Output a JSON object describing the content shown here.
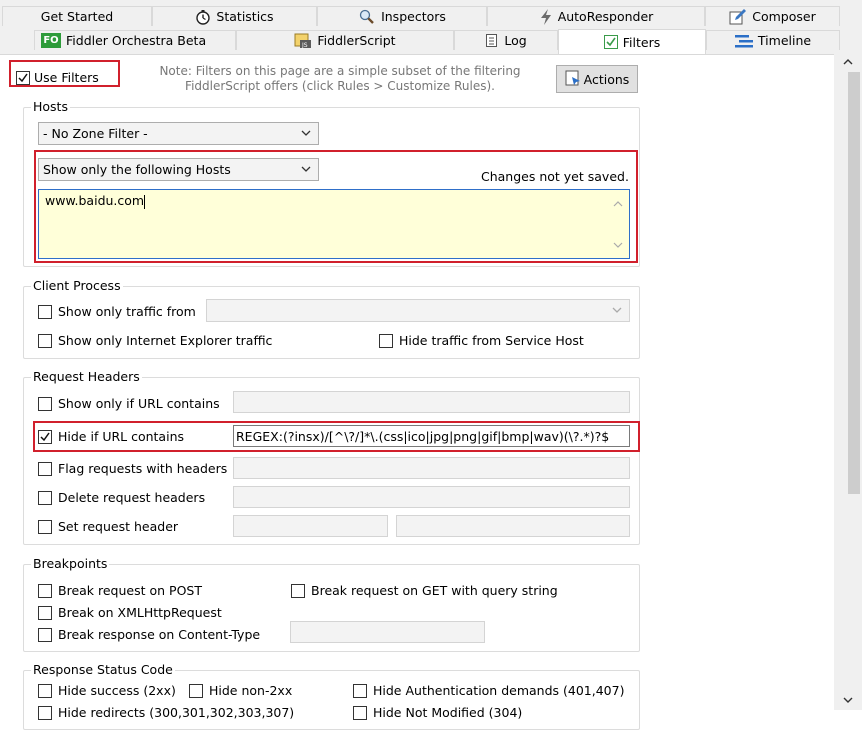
{
  "tabs": {
    "row1": [
      {
        "label": "Get Started"
      },
      {
        "label": "Statistics"
      },
      {
        "label": "Inspectors"
      },
      {
        "label": "AutoResponder"
      },
      {
        "label": "Composer"
      }
    ],
    "row2": [
      {
        "label": "Fiddler Orchestra Beta",
        "badge": "FO"
      },
      {
        "label": "FiddlerScript"
      },
      {
        "label": "Log"
      },
      {
        "label": "Filters"
      },
      {
        "label": "Timeline"
      }
    ]
  },
  "top": {
    "use_filters": "Use Filters",
    "note": "Note: Filters on this page are a simple subset of the filtering FiddlerScript offers (click Rules > Customize Rules).",
    "note_line1": "Note: Filters on this page are a simple subset of the filtering",
    "note_line2": "FiddlerScript offers (click Rules > Customize Rules).",
    "actions": "Actions"
  },
  "hosts": {
    "legend": "Hosts",
    "zone_filter": "- No Zone Filter -",
    "host_filter": "Show only the following Hosts",
    "status": "Changes not yet saved.",
    "host_list": "www.baidu.com"
  },
  "client": {
    "legend": "Client Process",
    "show_only_traffic_from": "Show only traffic from",
    "show_only_ie": "Show only Internet Explorer traffic",
    "hide_service_host": "Hide traffic from Service Host"
  },
  "request_headers": {
    "legend": "Request Headers",
    "show_if_url": "Show only if URL contains",
    "hide_if_url": "Hide if URL contains",
    "hide_if_url_value": "REGEX:(?insx)/[^\\?/]*\\.(css|ico|jpg|png|gif|bmp|wav)(\\?.*)?$",
    "flag_requests": "Flag requests with headers",
    "delete_headers": "Delete request headers",
    "set_header": "Set request header"
  },
  "breakpoints": {
    "legend": "Breakpoints",
    "break_post": "Break request on POST",
    "break_get_qs": "Break request on GET with query string",
    "break_xhr": "Break on XMLHttpRequest",
    "break_content_type": "Break response on Content-Type"
  },
  "status_code": {
    "legend": "Response Status Code",
    "hide_success": "Hide success (2xx)",
    "hide_non2xx": "Hide non-2xx",
    "hide_auth": "Hide Authentication demands (401,407)",
    "hide_redirects": "Hide redirects (300,301,302,303,307)",
    "hide_not_modified": "Hide Not Modified (304)"
  },
  "colors": {
    "accent_red": "#d1202c",
    "hostlist_bg": "#ffffd9",
    "tab_bg": "#f0f0f0"
  }
}
